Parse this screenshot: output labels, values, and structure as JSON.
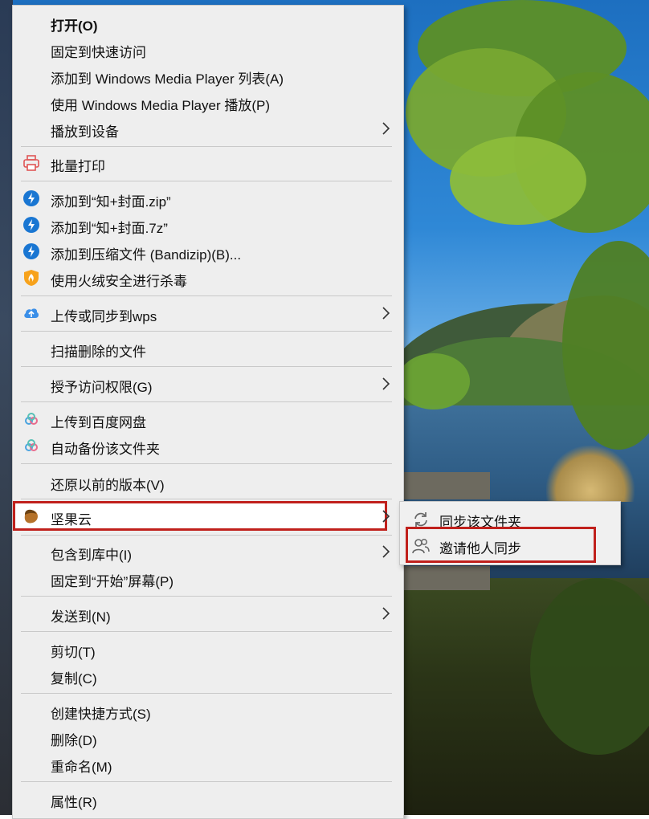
{
  "menu": {
    "items": [
      {
        "label": "打开(O)",
        "bold": true
      },
      {
        "label": "固定到快速访问"
      },
      {
        "label": "添加到 Windows Media Player 列表(A)"
      },
      {
        "label": "使用 Windows Media Player 播放(P)"
      },
      {
        "label": "播放到设备",
        "submenu": true
      },
      {
        "label": "批量打印",
        "icon": "printer-icon"
      },
      {
        "label": "添加到“知+封面.zip”",
        "icon": "bandizip-icon"
      },
      {
        "label": "添加到“知+封面.7z”",
        "icon": "bandizip-icon"
      },
      {
        "label": "添加到压缩文件 (Bandizip)(B)...",
        "icon": "bandizip-icon"
      },
      {
        "label": "使用火绒安全进行杀毒",
        "icon": "huorong-shield-icon"
      },
      {
        "label": "上传或同步到wps",
        "icon": "wps-cloud-upload-icon",
        "submenu": true
      },
      {
        "label": "扫描删除的文件"
      },
      {
        "label": "授予访问权限(G)",
        "submenu": true
      },
      {
        "label": "上传到百度网盘",
        "icon": "baidu-netdisk-icon"
      },
      {
        "label": "自动备份该文件夹",
        "icon": "baidu-netdisk-icon"
      },
      {
        "label": "还原以前的版本(V)"
      },
      {
        "label": "坚果云",
        "icon": "nutstore-acorn-icon",
        "submenu": true,
        "highlighted": true
      },
      {
        "label": "包含到库中(I)",
        "submenu": true
      },
      {
        "label": "固定到“开始”屏幕(P)"
      },
      {
        "label": "发送到(N)",
        "submenu": true
      },
      {
        "label": "剪切(T)"
      },
      {
        "label": "复制(C)"
      },
      {
        "label": "创建快捷方式(S)"
      },
      {
        "label": "删除(D)"
      },
      {
        "label": "重命名(M)"
      },
      {
        "label": "属性(R)"
      }
    ]
  },
  "submenu": {
    "items": [
      {
        "label": "同步该文件夹",
        "icon": "sync-icon"
      },
      {
        "label": "邀请他人同步",
        "icon": "invite-users-icon",
        "highlighted": true
      }
    ]
  },
  "colors": {
    "menu_bg": "#eeeeee",
    "highlight_border": "#c0201c",
    "bandizip_blue": "#1976d2",
    "printer_red": "#e05555",
    "acorn_brown": "#b5722a"
  }
}
